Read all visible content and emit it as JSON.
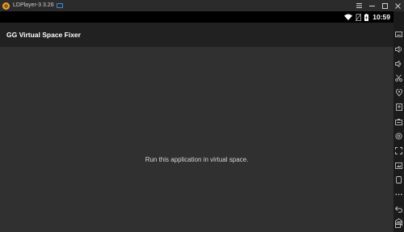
{
  "window": {
    "title": "LDPlayer-3 3.26",
    "controls": [
      {
        "name": "menu-icon",
        "symbol": "menu"
      },
      {
        "name": "minimize-icon",
        "symbol": "minimize"
      },
      {
        "name": "maximize-icon",
        "symbol": "maximize"
      },
      {
        "name": "close-icon",
        "symbol": "close"
      }
    ]
  },
  "statusbar": {
    "time": "10:59",
    "icons": [
      "wifi-icon",
      "no-sim-icon",
      "battery-charging-icon"
    ]
  },
  "appbar": {
    "title": "GG Virtual Space Fixer"
  },
  "content": {
    "message": "Run this application in virtual space."
  },
  "sidebar": {
    "icons": [
      "keyboard-icon",
      "volume-up-icon",
      "volume-down-icon",
      "scissors-icon",
      "location-icon",
      "install-apk-icon",
      "shared-folder-icon",
      "settings-icon",
      "fullscreen-icon",
      "screenshot-icon",
      "shake-icon",
      "more-icon",
      "back-icon",
      "home-icon",
      "recent-apps-icon"
    ]
  },
  "colors": {
    "titlebar_bg": "#2b2b2b",
    "statusbar_bg": "#000000",
    "appbar_bg": "#212121",
    "content_bg": "#303030",
    "sidebar_bg": "#1b1b1b",
    "logo_accent": "#f0a020",
    "badge_accent": "#3a8fd8"
  }
}
